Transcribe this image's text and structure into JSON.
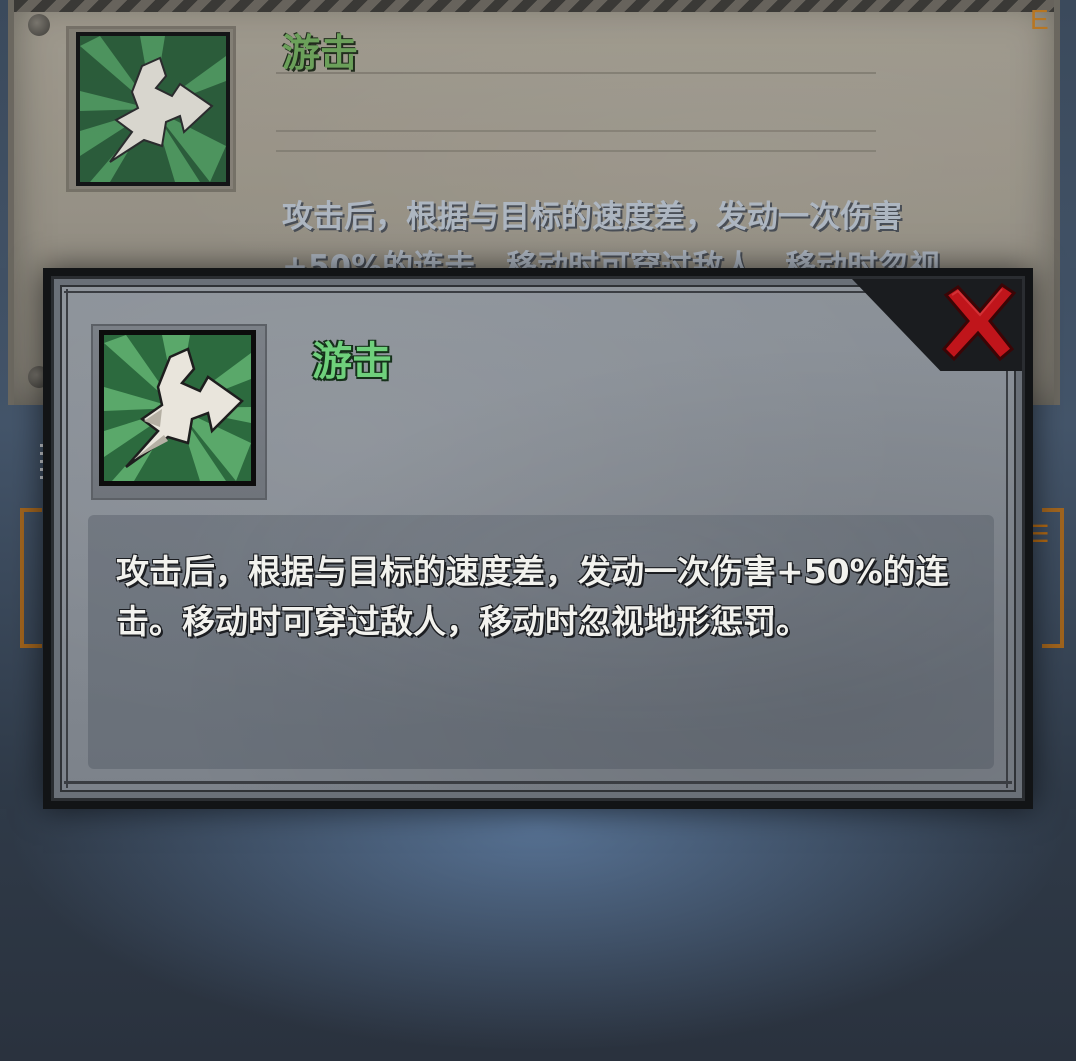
{
  "background_card": {
    "title": "游击",
    "description": "攻击后，根据与目标的速度差，发动一次伤害+50%的连击。移动时可穿过敌人，移动时忽视地形惩罚。",
    "corner_letter": "E"
  },
  "dialog": {
    "title": "游击",
    "description": "攻击后，根据与目标的速度差，发动一次伤害+50%的连击。移动时可穿过敌人，移动时忽视地形惩罚。",
    "icon": "skirmish-skill-icon",
    "close_icon": "red-x-close-icon"
  },
  "colors": {
    "title_green": "#6fd07c",
    "close_red": "#c0151b",
    "icon_green": "#2c6a3e",
    "accent_orange": "#b36a14"
  }
}
